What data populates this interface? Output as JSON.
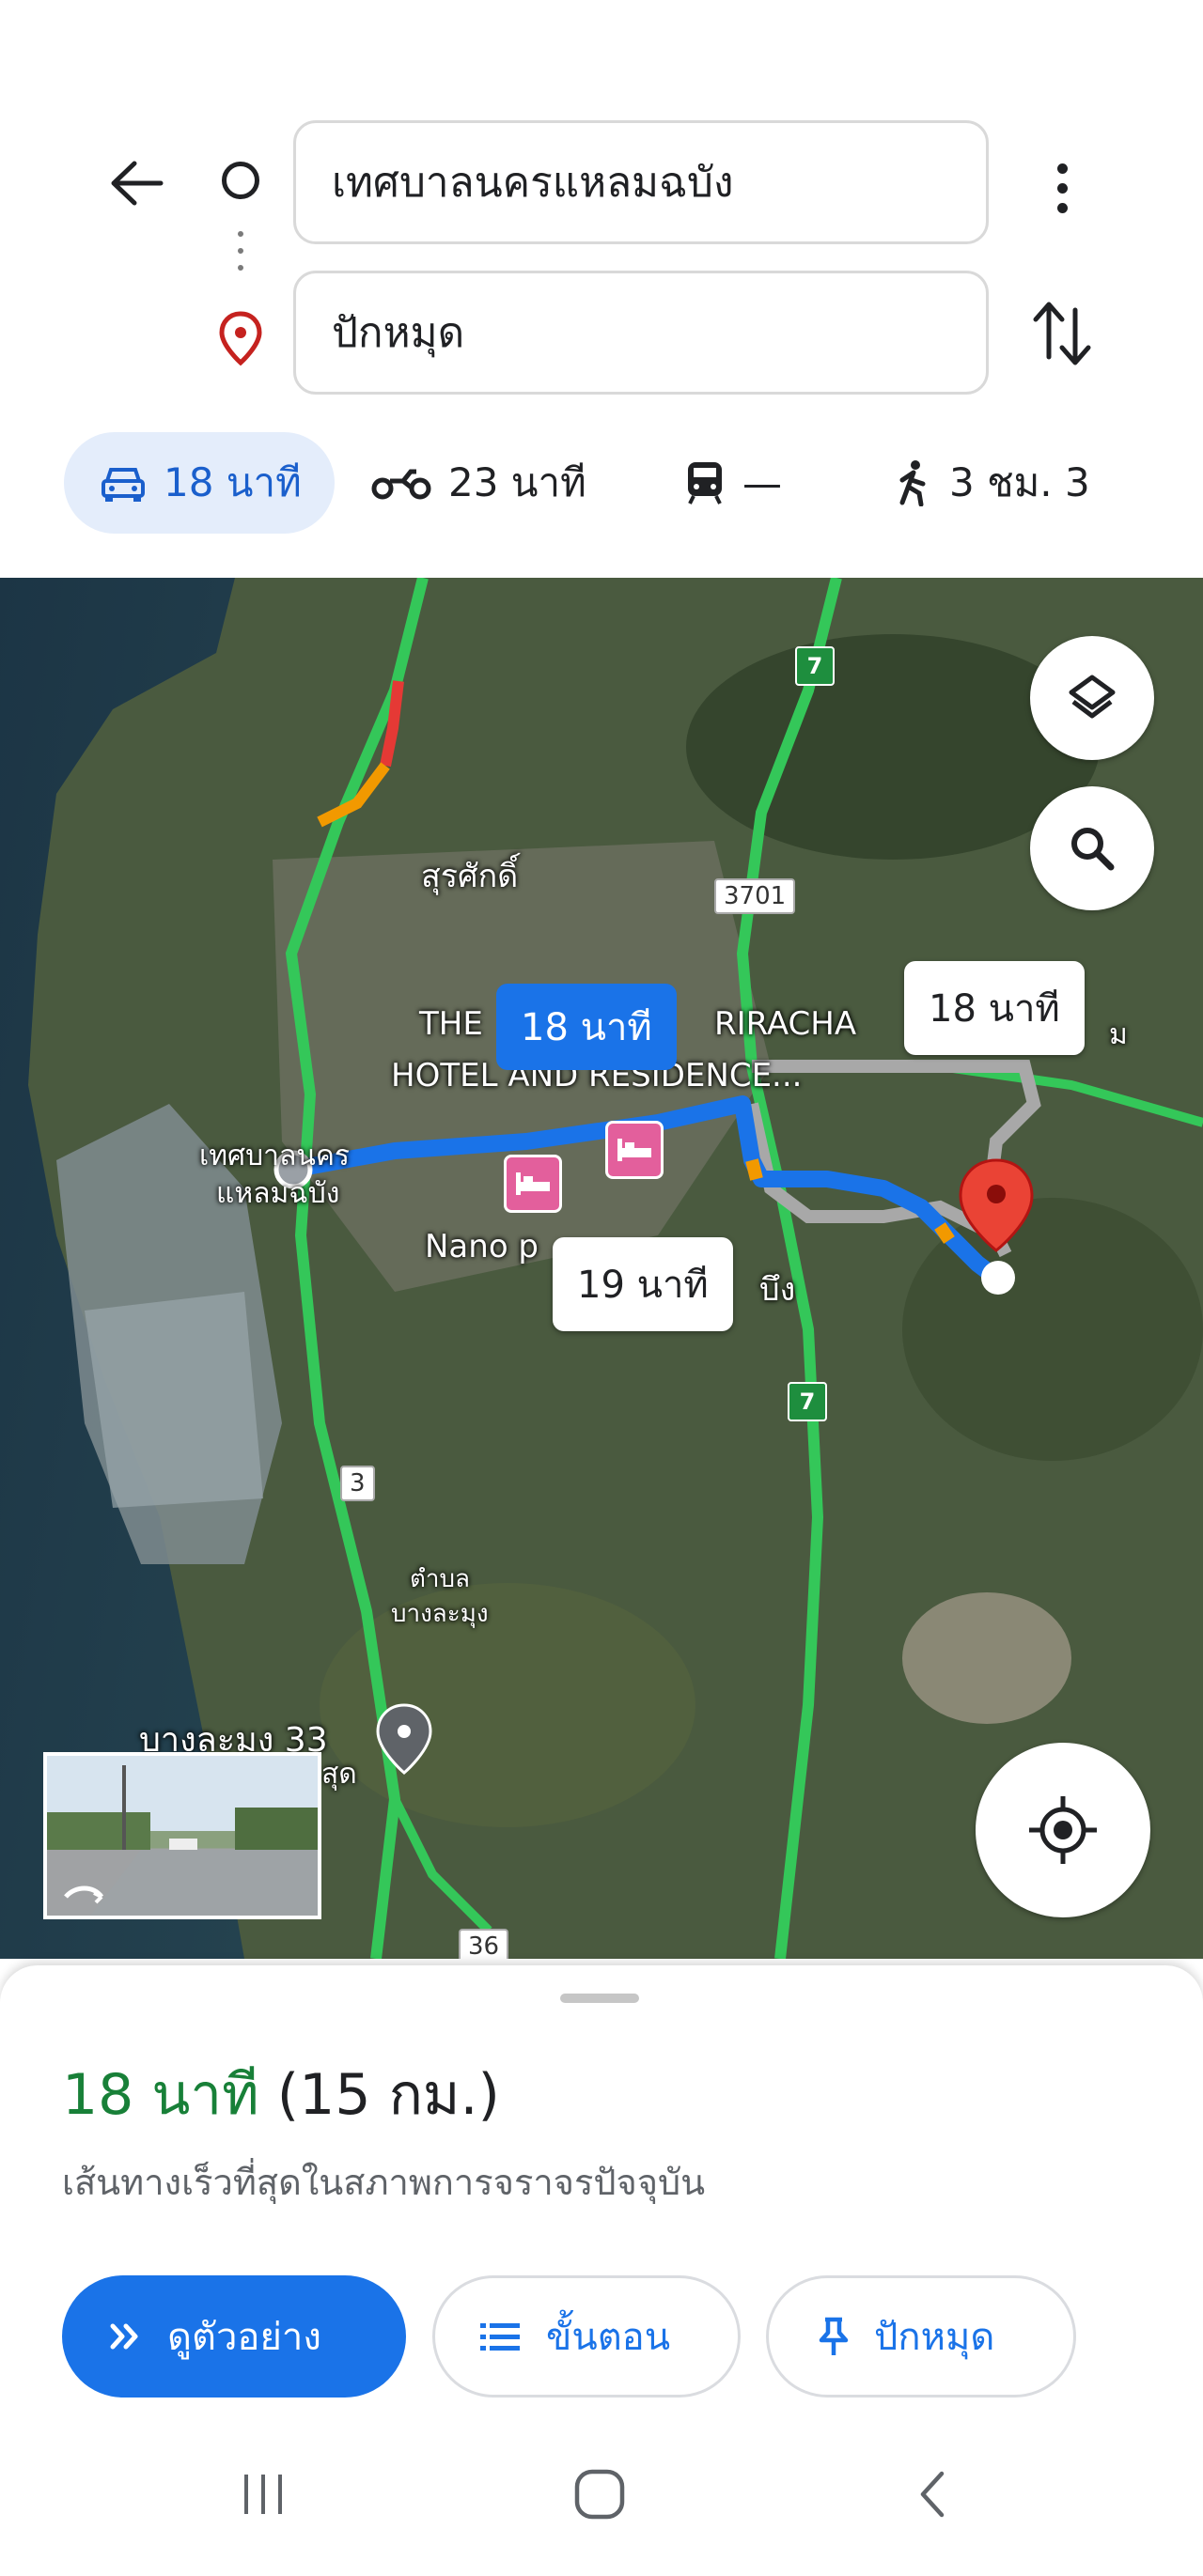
{
  "header": {
    "origin_value": "เทศบาลนครแหลมฉบัง",
    "destination_value": "ปักหมุด"
  },
  "modes": [
    {
      "icon": "car-icon",
      "label": "18 นาที",
      "selected": true
    },
    {
      "icon": "motorcycle-icon",
      "label": "23 นาที"
    },
    {
      "icon": "transit-icon",
      "label": "—"
    },
    {
      "icon": "walk-icon",
      "label": "3 ชม. 3"
    }
  ],
  "map": {
    "labels": {
      "surasak": "สุรศักดิ์",
      "hotel_line1": "THE",
      "hotel_line1b": "RIRACHA",
      "hotel_line2": "HOTEL AND RESIDENCE...",
      "origin_l1": "เทศบาลนคร",
      "origin_l2": "แหลมฉบัง",
      "nano": "Nano p",
      "bueng": "บึง",
      "tambon_l1": "ตำบล",
      "tambon_l2": "บางละมุง",
      "banglamung": "บางละมุง 33",
      "sut": "สุด",
      "right_edge": "ม"
    },
    "route_numbers": {
      "r3701": "3701",
      "r3": "3",
      "r36": "36"
    },
    "shields": {
      "top": "7",
      "mid": "7"
    },
    "time_chips": {
      "selected": "18 นาที",
      "alt1": "18 นาที",
      "alt2": "19 นาที"
    },
    "colors": {
      "route_selected": "#1a73e8",
      "route_alt": "#a8a8a8",
      "highway": "#34c759",
      "pin": "#ea4335"
    }
  },
  "sheet": {
    "eta_time": "18 นาที",
    "eta_distance": "(15 กม.)",
    "route_desc": "เส้นทางเร็วที่สุดในสภาพการจราจรปัจจุบัน",
    "btn_preview": "ดูตัวอย่าง",
    "btn_steps": "ขั้นตอน",
    "btn_pin": "ปักหมุด",
    "eta_color": "#188038",
    "accent": "#1a73e8"
  },
  "navbar": {
    "items": [
      "recent-apps-icon",
      "home-icon",
      "back-icon"
    ]
  }
}
